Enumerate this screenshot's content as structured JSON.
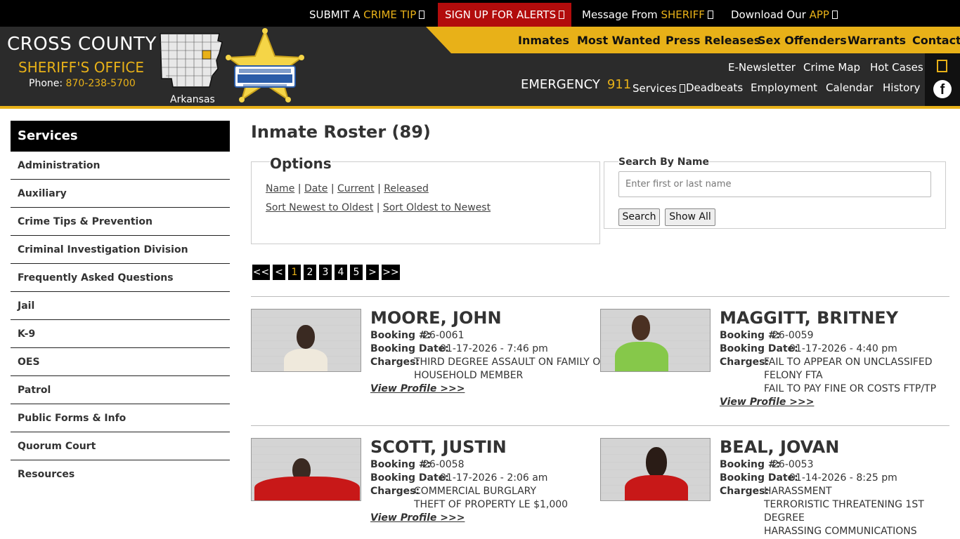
{
  "topbar": {
    "crime_tip": {
      "prefix": "SUBMIT A ",
      "highlight": "CRIME TIP"
    },
    "alerts": {
      "label": "SIGN UP FOR ALERTS"
    },
    "message": {
      "prefix": "Message From ",
      "highlight": "SHERIFF"
    },
    "app": {
      "prefix": "Download Our ",
      "highlight": "APP"
    }
  },
  "brand": {
    "title": "CROSS COUNTY",
    "subtitle": "SHERIFF'S OFFICE",
    "phone_label": "Phone: ",
    "phone": "870-238-5700",
    "state_label": "Arkansas"
  },
  "main_nav": [
    "Inmates",
    "Most Wanted",
    "Press Releases",
    "Sex Offenders",
    "Warrants",
    "Contact"
  ],
  "emergency": {
    "label": "EMERGENCY",
    "number": "911"
  },
  "sub_nav_top": [
    "E-Newsletter",
    "Crime Map",
    "Hot Cases"
  ],
  "sub_nav_bottom": [
    "Services",
    "Deadbeats",
    "Employment",
    "Calendar",
    "History"
  ],
  "sidebar": {
    "title": "Services",
    "items": [
      "Administration",
      "Auxiliary",
      "Crime Tips & Prevention",
      "Criminal Investigation Division",
      "Frequently Asked Questions",
      "Jail",
      "K-9",
      "OES",
      "Patrol",
      "Public Forms & Info",
      "Quorum Court",
      "Resources"
    ]
  },
  "page": {
    "title": "Inmate Roster (89)"
  },
  "options": {
    "legend": "Options",
    "filters": [
      "Name",
      "Date",
      "Current",
      "Released"
    ],
    "sorts": [
      "Sort Newest to Oldest",
      "Sort Oldest to Newest"
    ],
    "separator": "|"
  },
  "search": {
    "legend": "Search By Name",
    "placeholder": "Enter first or last name",
    "search_button": "Search",
    "show_all_button": "Show All"
  },
  "pagination": [
    "<<",
    "<",
    "1",
    "2",
    "3",
    "4",
    "5",
    ">",
    ">>"
  ],
  "labels": {
    "booking_no": "Booking #:",
    "booking_date": "Booking Date:",
    "charges": "Charges:",
    "view_profile": "View Profile >>>"
  },
  "inmates": [
    {
      "name": "MOORE, JOHN",
      "booking_no": "26-0061",
      "booking_date": "01-17-2026 - 7:46 pm",
      "charges": [
        "THIRD DEGREE ASSAULT ON FAMILY OR",
        "HOUSEHOLD MEMBER"
      ]
    },
    {
      "name": "MAGGITT, BRITNEY",
      "booking_no": "26-0059",
      "booking_date": "01-17-2026 - 4:40 pm",
      "charges": [
        "FAIL TO APPEAR ON UNCLASSIFED",
        "FELONY FTA",
        "FAIL TO PAY FINE OR COSTS FTP/TP"
      ]
    },
    {
      "name": "SCOTT, JUSTIN",
      "booking_no": "26-0058",
      "booking_date": "01-17-2026 - 2:06 am",
      "charges": [
        "COMMERCIAL BURGLARY",
        "THEFT OF PROPERTY LE $1,000"
      ]
    },
    {
      "name": "BEAL, JOVAN",
      "booking_no": "26-0053",
      "booking_date": "01-14-2026 - 8:25 pm",
      "charges": [
        "HARASSMENT",
        "TERRORISTIC THREATENING 1ST",
        "DEGREE",
        "HARASSING COMMUNICATIONS"
      ]
    }
  ],
  "colors": {
    "accent": "#e8b118",
    "alert": "#b20c0c",
    "header_bg": "#2b2b2b"
  }
}
